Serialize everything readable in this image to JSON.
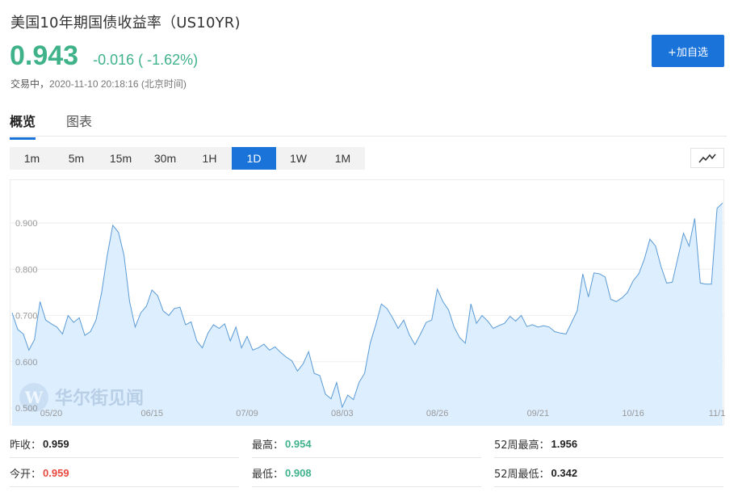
{
  "header": {
    "title": "美国10年期国债收益率（US10YR)",
    "price": "0.943",
    "change": "-0.016 ( -1.62%)",
    "status_label": "交易中，",
    "timestamp": "2020-11-10 20:18:16 (北京时间)",
    "add_button": "+加自选"
  },
  "tabs": [
    {
      "label": "概览",
      "active": true
    },
    {
      "label": "图表",
      "active": false
    }
  ],
  "ranges": [
    {
      "label": "1m",
      "active": false
    },
    {
      "label": "5m",
      "active": false
    },
    {
      "label": "15m",
      "active": false
    },
    {
      "label": "30m",
      "active": false
    },
    {
      "label": "1H",
      "active": false
    },
    {
      "label": "1D",
      "active": true
    },
    {
      "label": "1W",
      "active": false
    },
    {
      "label": "1M",
      "active": false
    }
  ],
  "watermark": "华尔街见闻",
  "colors": {
    "up": "#e8483d",
    "down": "#3fb28a",
    "accent": "#1a73d9",
    "line": "#5b9bd5",
    "area": "#ddeeff"
  },
  "chart_data": {
    "type": "area",
    "ylim": [
      0.5,
      0.95
    ],
    "yticks": [
      "0.900",
      "0.800",
      "0.700",
      "0.600",
      "0.500"
    ],
    "ytick_values": [
      0.9,
      0.8,
      0.7,
      0.6,
      0.5
    ],
    "xticks": [
      "05/20",
      "06/15",
      "07/09",
      "08/03",
      "08/26",
      "09/21",
      "10/16",
      "11/1"
    ],
    "xtick_index": [
      7,
      25,
      42,
      59,
      76,
      94,
      111,
      126
    ],
    "grid": true,
    "values": [
      0.706,
      0.67,
      0.66,
      0.625,
      0.648,
      0.73,
      0.69,
      0.682,
      0.675,
      0.66,
      0.7,
      0.685,
      0.695,
      0.657,
      0.665,
      0.69,
      0.75,
      0.83,
      0.895,
      0.88,
      0.83,
      0.73,
      0.675,
      0.706,
      0.72,
      0.755,
      0.743,
      0.71,
      0.7,
      0.715,
      0.718,
      0.68,
      0.686,
      0.645,
      0.63,
      0.662,
      0.68,
      0.672,
      0.682,
      0.645,
      0.675,
      0.63,
      0.655,
      0.625,
      0.63,
      0.638,
      0.625,
      0.632,
      0.62,
      0.61,
      0.602,
      0.58,
      0.595,
      0.622,
      0.575,
      0.57,
      0.53,
      0.52,
      0.555,
      0.502,
      0.528,
      0.518,
      0.555,
      0.575,
      0.64,
      0.68,
      0.725,
      0.715,
      0.695,
      0.672,
      0.69,
      0.658,
      0.637,
      0.66,
      0.685,
      0.69,
      0.757,
      0.73,
      0.712,
      0.675,
      0.652,
      0.64,
      0.725,
      0.683,
      0.7,
      0.688,
      0.672,
      0.678,
      0.683,
      0.698,
      0.688,
      0.7,
      0.676,
      0.68,
      0.675,
      0.678,
      0.675,
      0.665,
      0.662,
      0.66,
      0.685,
      0.71,
      0.79,
      0.74,
      0.792,
      0.79,
      0.783,
      0.735,
      0.73,
      0.738,
      0.75,
      0.775,
      0.79,
      0.822,
      0.865,
      0.85,
      0.805,
      0.77,
      0.772,
      0.825,
      0.878,
      0.85,
      0.91,
      0.77,
      0.768,
      0.768,
      0.932,
      0.943
    ]
  },
  "stats": [
    [
      {
        "label": "昨收：",
        "value": "0.959",
        "tone": "dark"
      },
      {
        "label": "最高：",
        "value": "0.954",
        "tone": "green"
      },
      {
        "label": "52周最高：",
        "value": "1.956",
        "tone": "dark"
      }
    ],
    [
      {
        "label": "今开：",
        "value": "0.959",
        "tone": "red"
      },
      {
        "label": "最低：",
        "value": "0.908",
        "tone": "green"
      },
      {
        "label": "52周最低：",
        "value": "0.342",
        "tone": "dark"
      }
    ]
  ]
}
